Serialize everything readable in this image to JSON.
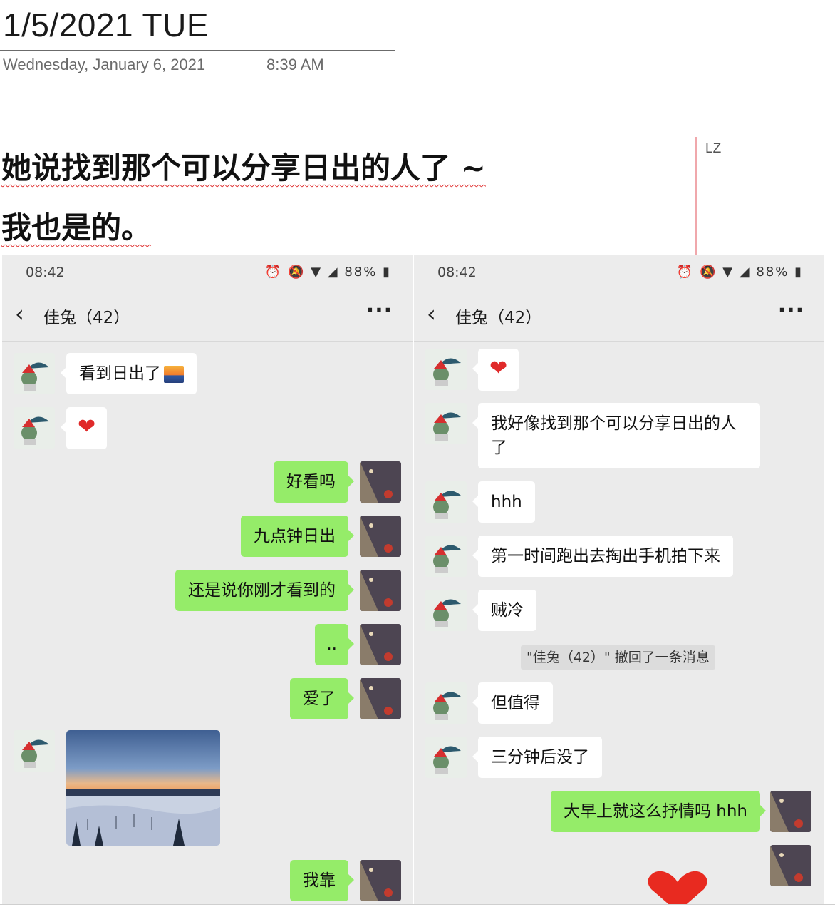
{
  "page": {
    "title": "1/5/2021 TUE",
    "date": "Wednesday, January 6, 2021",
    "time": "8:39 AM",
    "heading_line1": "她说找到那个可以分享日出的人了 ~",
    "heading_line2": "我也是的。",
    "author": "LZ"
  },
  "left_phone": {
    "status_time": "08:42",
    "battery": "88%",
    "chat_name": "佳兔（42）",
    "messages": [
      {
        "from": "other",
        "text": "看到日出了"
      },
      {
        "from": "other",
        "text": "❤"
      },
      {
        "from": "me",
        "text": "好看吗"
      },
      {
        "from": "me",
        "text": "九点钟日出"
      },
      {
        "from": "me",
        "text": "还是说你刚才看到的"
      },
      {
        "from": "me",
        "text": ".."
      },
      {
        "from": "me",
        "text": "爱了"
      },
      {
        "from": "other",
        "type": "photo"
      },
      {
        "from": "me",
        "text": "我靠"
      }
    ]
  },
  "right_phone": {
    "status_time": "08:42",
    "battery": "88%",
    "chat_name": "佳兔（42）",
    "messages": [
      {
        "from": "other",
        "text": "❤"
      },
      {
        "from": "other",
        "text": "我好像找到那个可以分享日出的人了"
      },
      {
        "from": "other",
        "text": "hhh"
      },
      {
        "from": "other",
        "text": "第一时间跑出去掏出手机拍下来"
      },
      {
        "from": "other",
        "text": "贼冷"
      },
      {
        "from": "system",
        "text": "\"佳兔（42）\" 撤回了一条消息"
      },
      {
        "from": "other",
        "text": "但值得"
      },
      {
        "from": "other",
        "text": "三分钟后没了"
      },
      {
        "from": "me",
        "text": "大早上就这么抒情吗 hhh"
      },
      {
        "from": "me",
        "type": "sticker"
      }
    ]
  },
  "icons": {
    "status": [
      "alarm-icon",
      "mute-icon",
      "wifi-icon",
      "signal-icon",
      "battery-icon"
    ],
    "nav": [
      "back-icon",
      "more-icon"
    ]
  },
  "colors": {
    "my_bubble": "#95ec69",
    "their_bubble": "#ffffff",
    "chat_background": "#ebebeb",
    "author_bar": "#f0a8ac",
    "spellcheck": "#e03030"
  }
}
